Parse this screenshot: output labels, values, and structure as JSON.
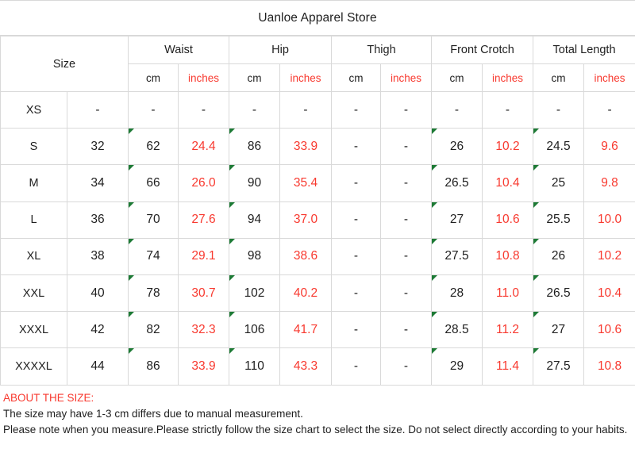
{
  "title": "Uanloe Apparel Store",
  "table": {
    "size_header": "Size",
    "groups": [
      {
        "label": "Waist"
      },
      {
        "label": "Hip"
      },
      {
        "label": "Thigh"
      },
      {
        "label": "Front Crotch"
      },
      {
        "label": "Total Length"
      }
    ],
    "units": {
      "cm": "cm",
      "inches": "inches"
    },
    "rows": [
      {
        "size": "XS",
        "size_num": "-",
        "waist_cm": "-",
        "waist_in": "-",
        "hip_cm": "-",
        "hip_in": "-",
        "thigh_cm": "-",
        "thigh_in": "-",
        "crotch_cm": "-",
        "crotch_in": "-",
        "length_cm": "-",
        "length_in": "-"
      },
      {
        "size": "S",
        "size_num": "32",
        "waist_cm": "62",
        "waist_in": "24.4",
        "hip_cm": "86",
        "hip_in": "33.9",
        "thigh_cm": "-",
        "thigh_in": "-",
        "crotch_cm": "26",
        "crotch_in": "10.2",
        "length_cm": "24.5",
        "length_in": "9.6"
      },
      {
        "size": "M",
        "size_num": "34",
        "waist_cm": "66",
        "waist_in": "26.0",
        "hip_cm": "90",
        "hip_in": "35.4",
        "thigh_cm": "-",
        "thigh_in": "-",
        "crotch_cm": "26.5",
        "crotch_in": "10.4",
        "length_cm": "25",
        "length_in": "9.8"
      },
      {
        "size": "L",
        "size_num": "36",
        "waist_cm": "70",
        "waist_in": "27.6",
        "hip_cm": "94",
        "hip_in": "37.0",
        "thigh_cm": "-",
        "thigh_in": "-",
        "crotch_cm": "27",
        "crotch_in": "10.6",
        "length_cm": "25.5",
        "length_in": "10.0"
      },
      {
        "size": "XL",
        "size_num": "38",
        "waist_cm": "74",
        "waist_in": "29.1",
        "hip_cm": "98",
        "hip_in": "38.6",
        "thigh_cm": "-",
        "thigh_in": "-",
        "crotch_cm": "27.5",
        "crotch_in": "10.8",
        "length_cm": "26",
        "length_in": "10.2"
      },
      {
        "size": "XXL",
        "size_num": "40",
        "waist_cm": "78",
        "waist_in": "30.7",
        "hip_cm": "102",
        "hip_in": "40.2",
        "thigh_cm": "-",
        "thigh_in": "-",
        "crotch_cm": "28",
        "crotch_in": "11.0",
        "length_cm": "26.5",
        "length_in": "10.4"
      },
      {
        "size": "XXXL",
        "size_num": "42",
        "waist_cm": "82",
        "waist_in": "32.3",
        "hip_cm": "106",
        "hip_in": "41.7",
        "thigh_cm": "-",
        "thigh_in": "-",
        "crotch_cm": "28.5",
        "crotch_in": "11.2",
        "length_cm": "27",
        "length_in": "10.6"
      },
      {
        "size": "XXXXL",
        "size_num": "44",
        "waist_cm": "86",
        "waist_in": "33.9",
        "hip_cm": "110",
        "hip_in": "43.3",
        "thigh_cm": "-",
        "thigh_in": "-",
        "crotch_cm": "29",
        "crotch_in": "11.4",
        "length_cm": "27.5",
        "length_in": "10.8"
      }
    ]
  },
  "notes": {
    "heading": "ABOUT THE SIZE:",
    "line1": "The size may have 1-3 cm differs due to manual measurement.",
    "line2": "Please note when you measure.Please strictly follow the size chart  to select the size. Do not select directly according to your habits."
  },
  "colors": {
    "accent_red": "#f8392f",
    "text": "#1f1f1f",
    "grid": "#d9d9d9",
    "flag_green": "#1d7a35"
  }
}
